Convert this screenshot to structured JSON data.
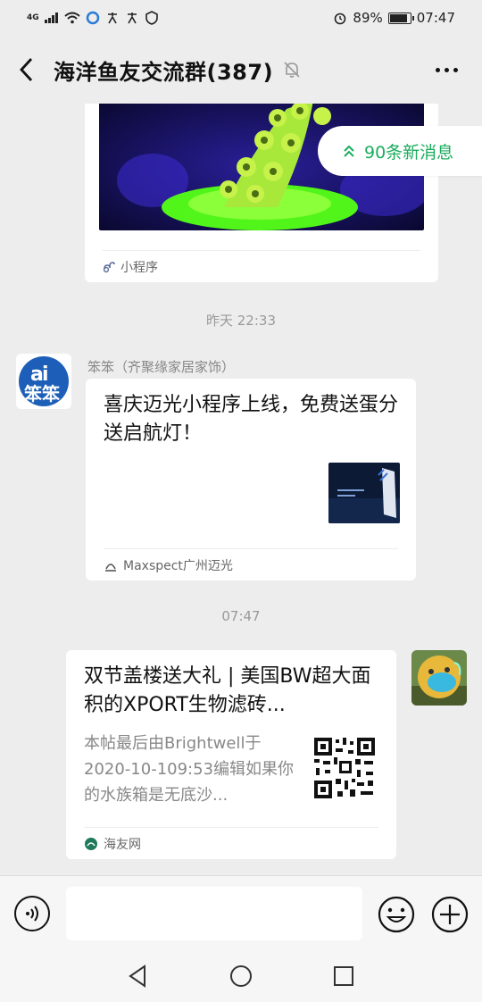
{
  "status_bar": {
    "signal": "4G",
    "battery": "89%",
    "battery_level": 0.89,
    "time": "07:47"
  },
  "header": {
    "title": "海洋鱼友交流群(387)",
    "icons": [
      "back-icon",
      "mute-bell-icon",
      "more-icon"
    ]
  },
  "new_messages_badge": "90条新消息",
  "messages": {
    "mini_program_card": {
      "source_label": "小程序"
    },
    "timestamp_1": "昨天 22:33",
    "msg_benben": {
      "sender": "笨笨（齐聚缘家居家饰）",
      "title": "喜庆迈光小程序上线，免费送蛋分送启航灯！",
      "source": "Maxspect广州迈光",
      "avatar_text": "笨笨"
    },
    "timestamp_2": "07:47",
    "msg_self": {
      "title": "双节盖楼送大礼 | 美国BW超大面积的XPORT生物滤砖...",
      "description": "本帖最后由Brightwell于2020-10-109:53编辑如果你的水族箱是无底沙...",
      "source": "海友网"
    }
  },
  "input_bar": {
    "placeholder": "",
    "icons": [
      "voice-icon",
      "emoji-icon",
      "plus-icon"
    ]
  },
  "system_nav": {
    "icons": [
      "nav-back-icon",
      "nav-home-icon",
      "nav-recents-icon"
    ]
  },
  "colors": {
    "accent_green": "#1aad5c",
    "background": "#ededed"
  }
}
